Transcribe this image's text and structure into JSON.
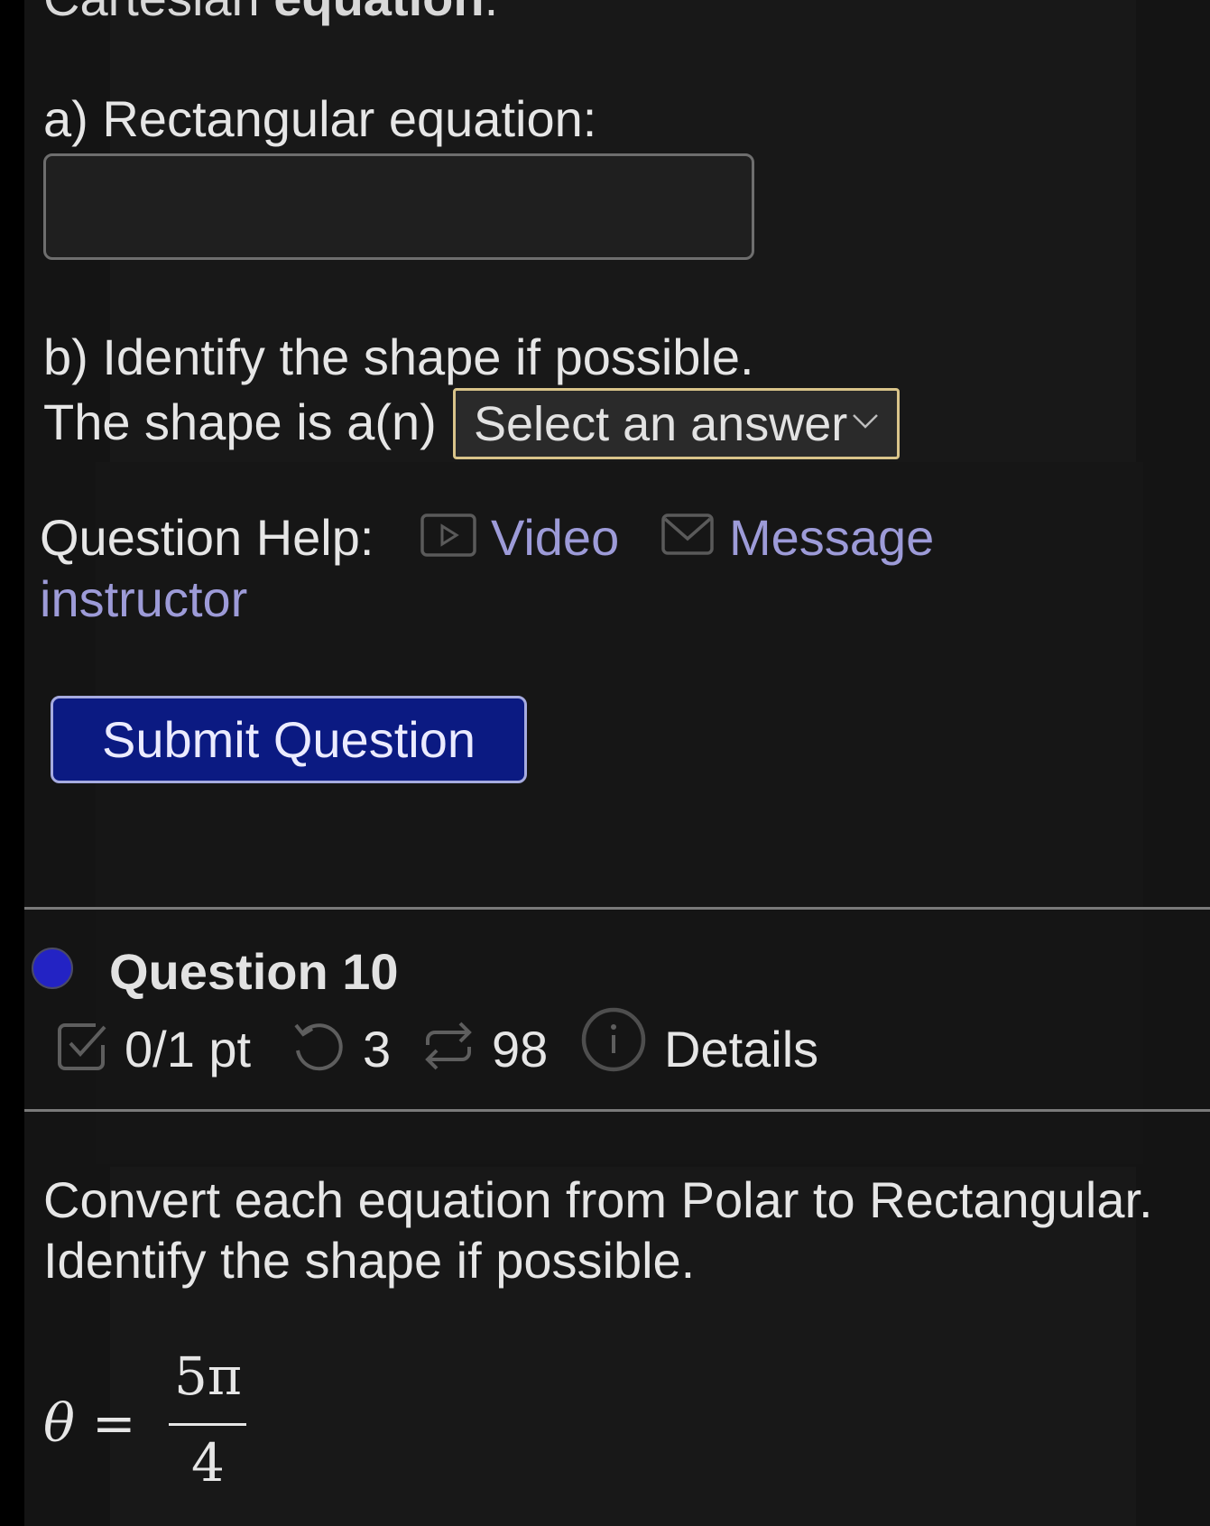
{
  "section_heading": {
    "prefix": "Cartesian ",
    "bold": "equation",
    "suffix": "."
  },
  "part_a": {
    "label": "a) Rectangular equation:",
    "input_value": ""
  },
  "part_b": {
    "label": "b) Identify the shape if possible.",
    "prefix": "The shape is a(n)",
    "select_value": "Select an answer"
  },
  "help": {
    "label": "Question Help:",
    "video_label": "Video",
    "message_label": "Message",
    "message_label_cont": "instructor"
  },
  "submit_label": "Submit Question",
  "question": {
    "title": "Question 10",
    "points": "0/1 pt",
    "attempts": "3",
    "tries": "98",
    "details_label": "Details",
    "prompt_line1": "Convert each equation from Polar to Rectangular.",
    "prompt_line2": "Identify the shape if possible.",
    "equation": {
      "lhs": "θ",
      "eq": "=",
      "numerator": "5π",
      "denominator": "4"
    }
  },
  "colors": {
    "link": "#9d9bd8",
    "submit_bg": "#0b1a82",
    "select_border": "#d9c48a",
    "status_dot": "#2323c4"
  },
  "icons": [
    "video-icon",
    "mail-icon",
    "checkbox-icon",
    "undo-icon",
    "retry-icon",
    "info-icon",
    "chevron-down-icon"
  ]
}
